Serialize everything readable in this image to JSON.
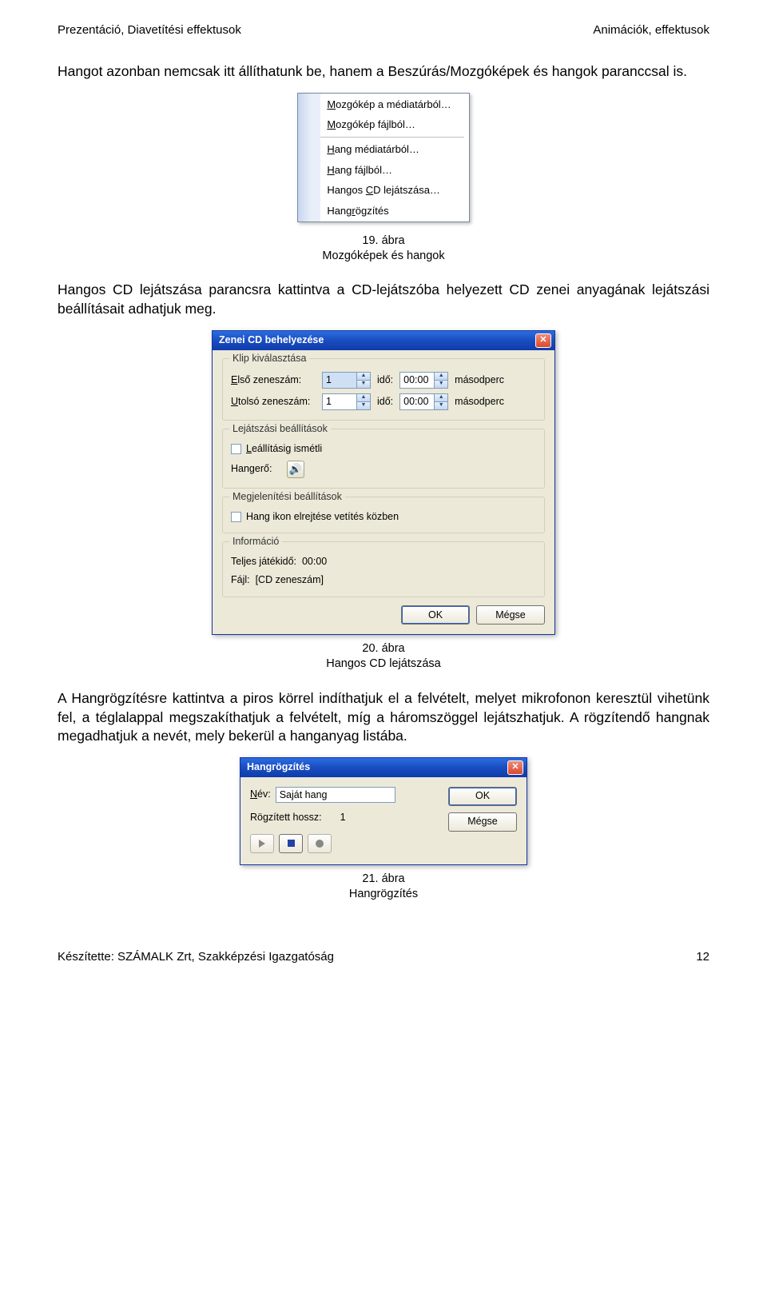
{
  "header": {
    "left": "Prezentáció, Diavetítési effektusok",
    "right": "Animációk, effektusok"
  },
  "para1": "Hangot azonban nemcsak itt állíthatunk be, hanem a Beszúrás/Mozgóképek és hangok paranccsal is.",
  "menu": {
    "items": [
      "Mozgókép a médiatárból…",
      "Mozgókép fájlból…",
      "Hang médiatárból…",
      "Hang fájlból…",
      "Hangos CD lejátszása…",
      "Hangrögzítés"
    ],
    "underlines": [
      "M",
      "M",
      "H",
      "H",
      "C",
      "r"
    ]
  },
  "cap19": {
    "line1": "19. ábra",
    "line2": "Mozgóképek és hangok"
  },
  "para2": "Hangos CD lejátszása parancsra kattintva a CD-lejátszóba helyezett CD zenei anyagának lejátszási beállításait adhatjuk meg.",
  "cdDialog": {
    "title": "Zenei CD behelyezése",
    "group1": {
      "legend": "Klip kiválasztása",
      "firstLabel": "Első zeneszám:",
      "firstVal": "1",
      "lastLabel": "Utolsó zeneszám:",
      "lastVal": "1",
      "timeLabel": "idő:",
      "timeVal": "00:00",
      "unit": "másodperc"
    },
    "group2": {
      "legend": "Lejátszási beállítások",
      "repeatLabel": "Leállításig ismétli",
      "volumeLabel": "Hangerő:"
    },
    "group3": {
      "legend": "Megjelenítési beállítások",
      "hideLabel": "Hang ikon elrejtése vetítés közben"
    },
    "group4": {
      "legend": "Információ",
      "totalLabel": "Teljes játékidő:",
      "totalVal": "00:00",
      "fileLabel": "Fájl:",
      "fileVal": "[CD zeneszám]"
    },
    "ok": "OK",
    "cancel": "Mégse"
  },
  "cap20": {
    "line1": "20. ábra",
    "line2": "Hangos CD lejátszása"
  },
  "para3": "A Hangrögzítésre kattintva a piros körrel indíthatjuk el a felvételt, melyet mikrofonon keresztül vihetünk fel, a téglalappal megszakíthatjuk a felvételt, míg a háromszöggel lejátszhatjuk. A rögzítendő hangnak megadhatjuk a nevét, mely bekerül a hanganyag listába.",
  "recDialog": {
    "title": "Hangrögzítés",
    "nameLabel": "Név:",
    "nameVal": "Saját hang",
    "lenLabel": "Rögzített hossz:",
    "lenVal": "1",
    "ok": "OK",
    "cancel": "Mégse"
  },
  "cap21": {
    "line1": "21. ábra",
    "line2": "Hangrögzítés"
  },
  "footer": {
    "left": "Készítette: SZÁMALK Zrt, Szakképzési Igazgatóság",
    "right": "12"
  }
}
